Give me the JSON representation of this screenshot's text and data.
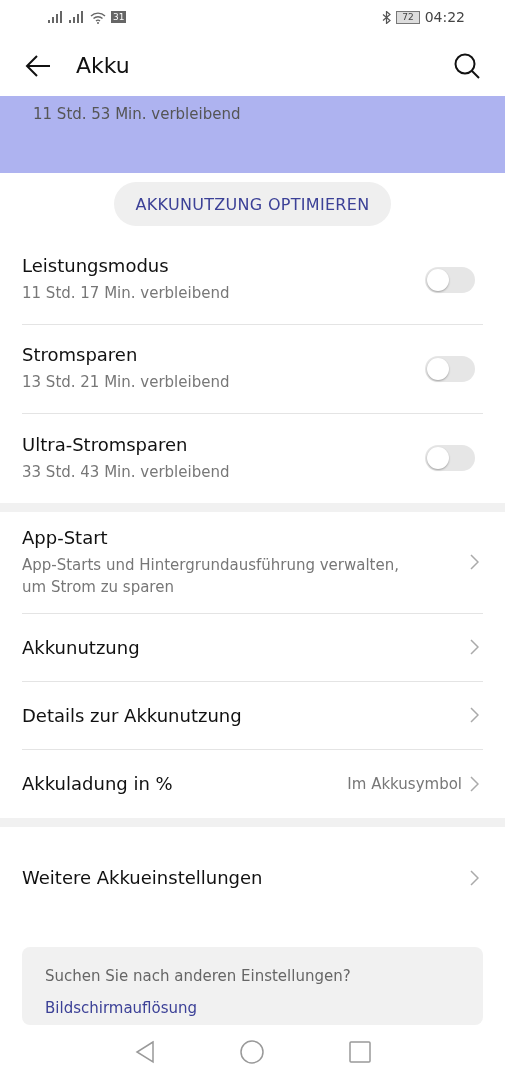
{
  "status_bar": {
    "calendar_day": "31",
    "battery": "72",
    "time": "04:22"
  },
  "header": {
    "title": "Akku"
  },
  "banner": {
    "remaining": "11 Std. 53 Min. verbleibend"
  },
  "optimize_button": "AKKUNUTZUNG OPTIMIEREN",
  "modes": [
    {
      "title": "Leistungsmodus",
      "subtitle": "11 Std. 17 Min. verbleibend",
      "on": false
    },
    {
      "title": "Stromsparen",
      "subtitle": "13 Std. 21 Min. verbleibend",
      "on": false
    },
    {
      "title": "Ultra-Stromsparen",
      "subtitle": "33 Std. 43 Min. verbleibend",
      "on": false
    }
  ],
  "settings": [
    {
      "title": "App-Start",
      "subtitle": "App-Starts und Hintergrundausführung verwalten, um Strom zu sparen"
    },
    {
      "title": "Akkunutzung"
    },
    {
      "title": "Details zur Akkunutzung"
    },
    {
      "title": "Akkuladung in %",
      "value": "Im Akkusymbol"
    }
  ],
  "more": {
    "title": "Weitere Akkueinstellungen"
  },
  "suggestions": {
    "heading": "Suchen Sie nach anderen Einstellungen?",
    "links": [
      "Bildschirmauflösung"
    ]
  }
}
